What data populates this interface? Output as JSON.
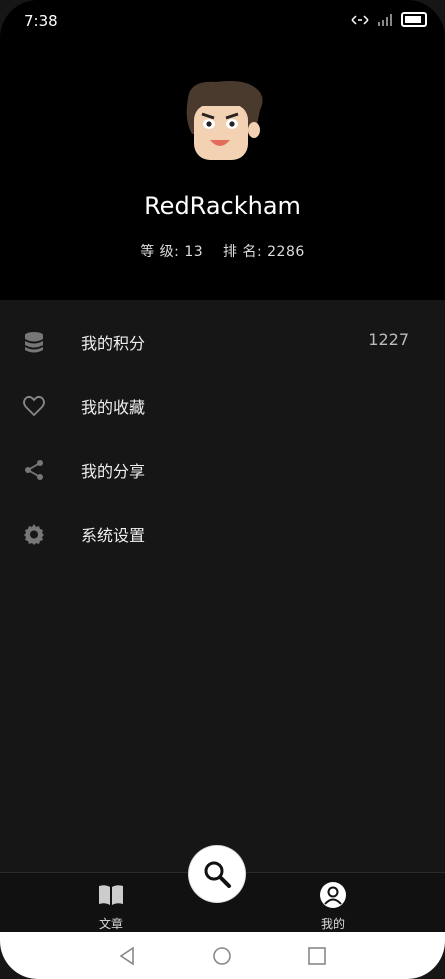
{
  "status_bar": {
    "time": "7:38"
  },
  "profile": {
    "username": "RedRackham",
    "level_label": "等 级:",
    "level": "13",
    "rank_label": "排 名:",
    "rank": "2286"
  },
  "menu": {
    "items": [
      {
        "label": "我的积分",
        "value": "1227",
        "icon": "database-icon"
      },
      {
        "label": "我的收藏",
        "icon": "heart-icon"
      },
      {
        "label": "我的分享",
        "icon": "share-icon"
      },
      {
        "label": "系统设置",
        "icon": "gear-icon"
      }
    ]
  },
  "tabbar": {
    "tabs": [
      {
        "label": "文章",
        "icon": "book-icon"
      },
      {
        "label": "我的",
        "icon": "user-icon"
      }
    ],
    "fab_icon": "search-icon"
  },
  "colors": {
    "header_bg": "#000000",
    "body_bg": "#161616",
    "accent": "#ffffff"
  }
}
